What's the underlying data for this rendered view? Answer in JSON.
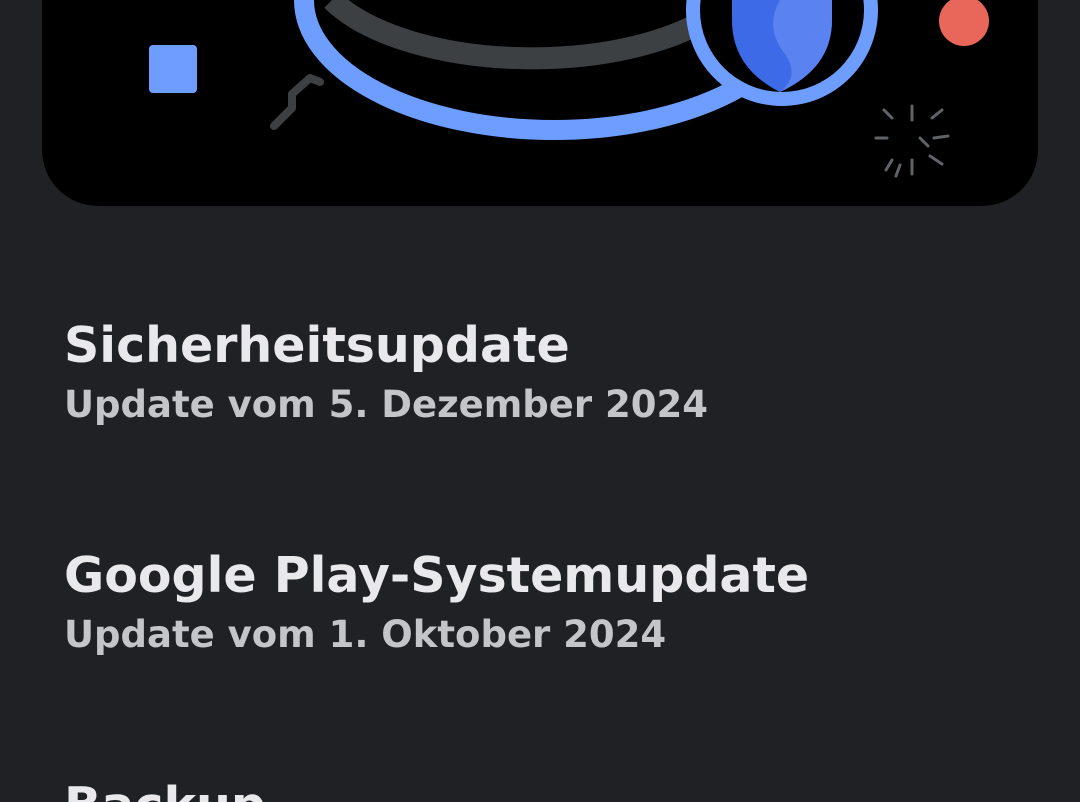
{
  "colors": {
    "background": "#202124",
    "hero_background": "#000000",
    "accent_blue": "#6d9eff",
    "shield_blue": "#3d6be8",
    "dot_red": "#e8675a",
    "ring_gray": "#3c4043"
  },
  "hero": {
    "icon": "security-shield-icon"
  },
  "updates": [
    {
      "title": "Sicherheitsupdate",
      "subtitle": "Update vom 5. Dezember 2024"
    },
    {
      "title": "Google Play-Systemupdate",
      "subtitle": "Update vom 1. Oktober 2024"
    },
    {
      "title": "Backup",
      "subtitle": ""
    }
  ]
}
